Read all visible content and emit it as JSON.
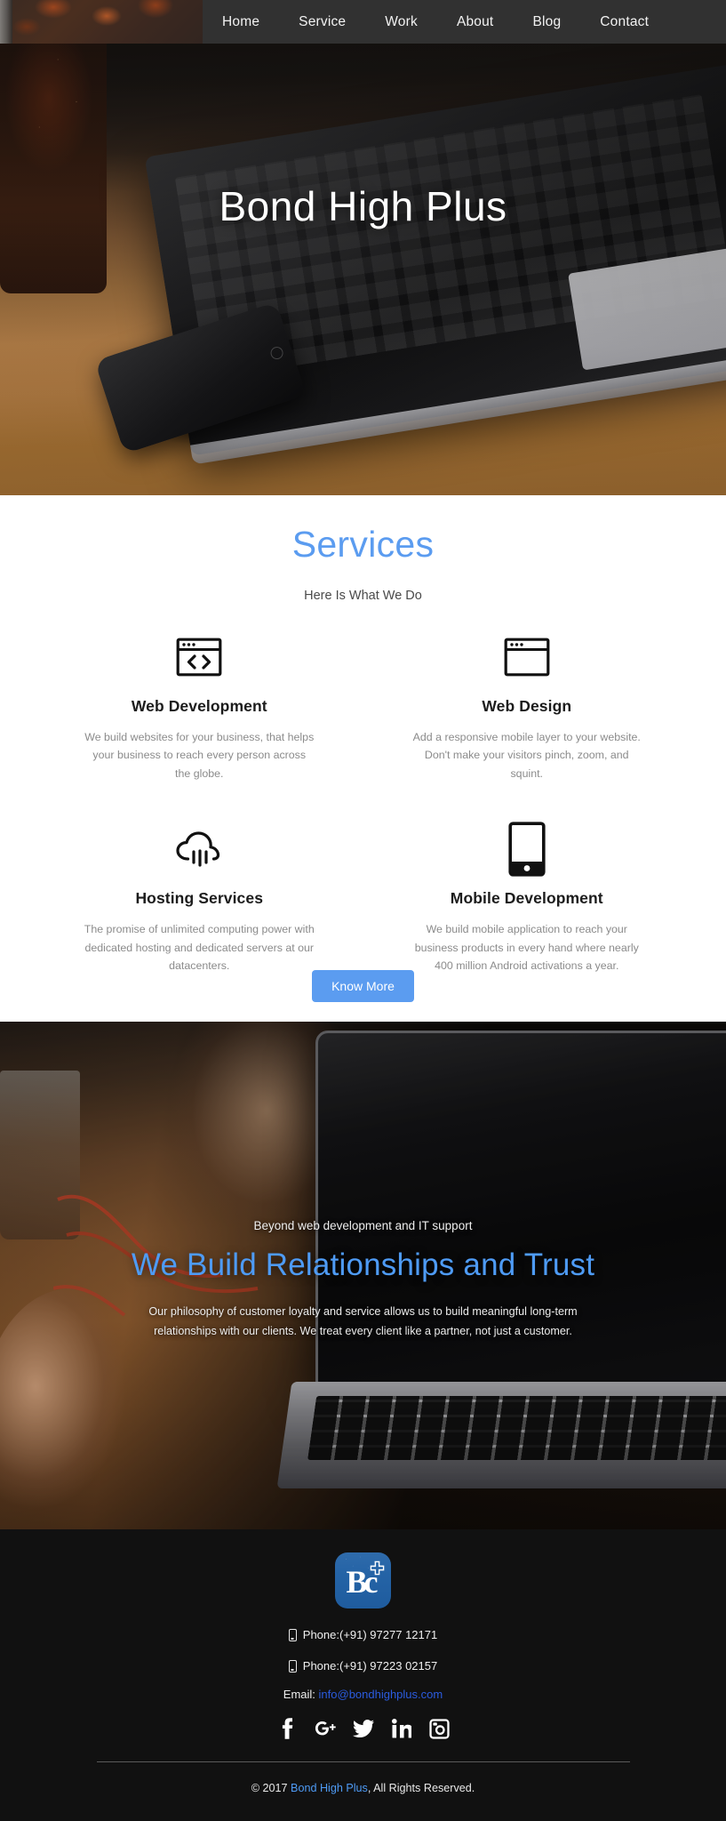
{
  "nav": {
    "items": [
      {
        "label": "Home",
        "name": "nav-item-home"
      },
      {
        "label": "Service",
        "name": "nav-item-service"
      },
      {
        "label": "Work",
        "name": "nav-item-work"
      },
      {
        "label": "About",
        "name": "nav-item-about"
      },
      {
        "label": "Blog",
        "name": "nav-item-blog"
      },
      {
        "label": "Contact",
        "name": "nav-item-contact"
      }
    ]
  },
  "hero": {
    "title": "Bond High Plus"
  },
  "services": {
    "title": "Services",
    "subtitle": "Here Is What We Do",
    "accent_color": "#5b9cf0",
    "cards": [
      {
        "icon": "browser-code-icon",
        "title": "Web Development",
        "desc": "We build websites for your business, that helps your business to reach every person across the globe."
      },
      {
        "icon": "browser-window-icon",
        "title": "Web Design",
        "desc": "Add a responsive mobile layer to your website. Don't make your visitors pinch, zoom, and squint."
      },
      {
        "icon": "cloud-rain-icon",
        "title": "Hosting Services",
        "desc": "The promise of unlimited computing power with dedicated hosting and dedicated servers at our datacenters."
      },
      {
        "icon": "mobile-phone-icon",
        "title": "Mobile Development",
        "desc": "We build mobile application to reach your business products in every hand where nearly 400 million Android activations a year."
      }
    ],
    "know_more_label": "Know More"
  },
  "parallax": {
    "eyebrow": "Beyond web development and IT support",
    "heading": "We Build Relationships and Trust",
    "paragraph": "Our philosophy of customer loyalty and service allows us to build meaningful long-term relationships with our clients. We treat every client like a partner, not just a customer.",
    "heading_color": "#4e9bf5"
  },
  "footer": {
    "logo_text": "Bc",
    "logo_color": "#2463a6",
    "phones": [
      {
        "label": "Phone:(+91) 97277 12171"
      },
      {
        "label": "Phone:(+91) 97223 02157"
      }
    ],
    "email_label": "Email:",
    "email": "info@bondhighplus.com",
    "email_color": "#2b5ce0",
    "socials": [
      {
        "name": "facebook-icon",
        "label": "Facebook"
      },
      {
        "name": "google-plus-icon",
        "label": "Google Plus"
      },
      {
        "name": "twitter-icon",
        "label": "Twitter"
      },
      {
        "name": "linkedin-icon",
        "label": "LinkedIn"
      },
      {
        "name": "instagram-icon",
        "label": "Instagram"
      }
    ],
    "copyright_prefix": "© 2017 ",
    "copyright_link": "Bond High Plus",
    "copyright_suffix": ", All Rights Reserved."
  }
}
